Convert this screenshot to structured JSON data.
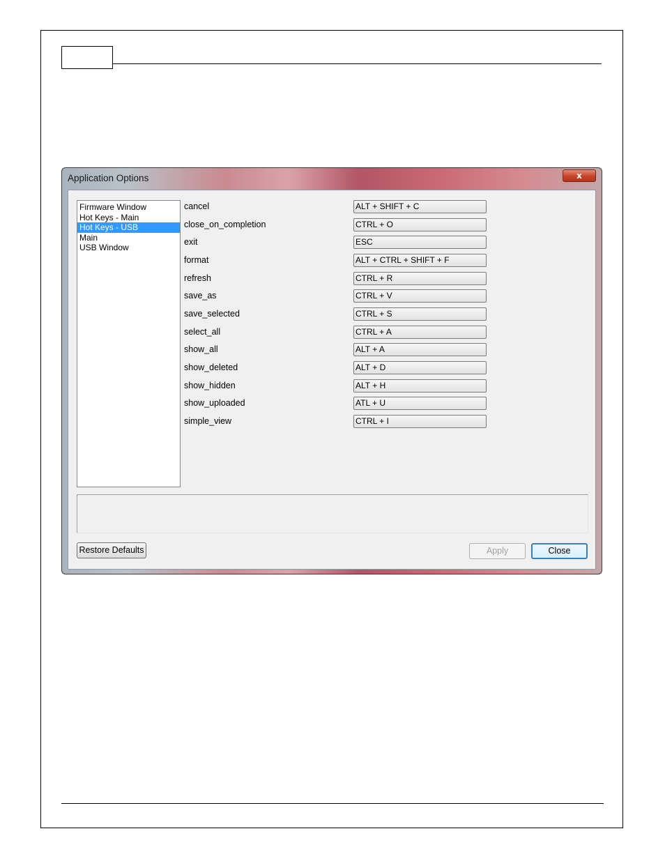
{
  "window": {
    "title": "Application Options",
    "close_glyph": "x",
    "close_icon": "close-icon"
  },
  "categories": [
    {
      "label": "Firmware Window",
      "selected": false
    },
    {
      "label": "Hot Keys - Main",
      "selected": false
    },
    {
      "label": "Hot Keys - USB",
      "selected": true
    },
    {
      "label": "Main",
      "selected": false
    },
    {
      "label": "USB Window",
      "selected": false
    }
  ],
  "hotkeys": [
    {
      "action": "cancel",
      "keys": "ALT + SHIFT + C"
    },
    {
      "action": "close_on_completion",
      "keys": "CTRL + O"
    },
    {
      "action": "exit",
      "keys": "ESC"
    },
    {
      "action": "format",
      "keys": "ALT + CTRL + SHIFT + F"
    },
    {
      "action": "refresh",
      "keys": "CTRL + R"
    },
    {
      "action": "save_as",
      "keys": "CTRL + V"
    },
    {
      "action": "save_selected",
      "keys": "CTRL + S"
    },
    {
      "action": "select_all",
      "keys": "CTRL + A"
    },
    {
      "action": "show_all",
      "keys": "ALT + A"
    },
    {
      "action": "show_deleted",
      "keys": "ALT + D"
    },
    {
      "action": "show_hidden",
      "keys": "ALT + H"
    },
    {
      "action": "show_uploaded",
      "keys": "ATL + U"
    },
    {
      "action": "simple_view",
      "keys": "CTRL + I"
    }
  ],
  "buttons": {
    "restore_defaults": "Restore Defaults",
    "apply": "Apply",
    "close": "Close"
  },
  "colors": {
    "selection": "#3399ff",
    "close_button": "#c7442b"
  }
}
